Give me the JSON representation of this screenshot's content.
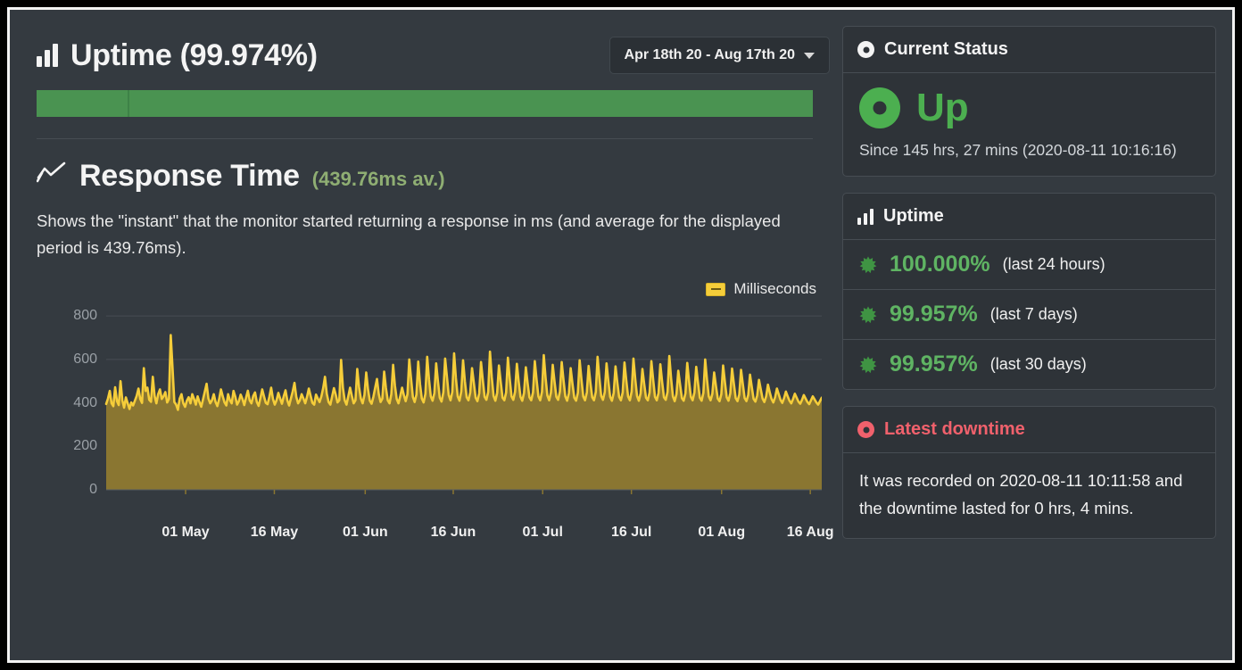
{
  "uptime_section": {
    "icon": "bar-chart-icon",
    "title": "Uptime (99.974%)",
    "date_range": "Apr 18th 20 - Aug 17th 20",
    "caret_icon": "chevron-down-icon",
    "bar_color": "#4a9351",
    "bar_segments": [
      {
        "label": "segment-1",
        "percent": 11.8
      },
      {
        "label": "segment-2",
        "percent": 88.2
      }
    ]
  },
  "response_section": {
    "icon": "line-chart-icon",
    "title": "Response Time",
    "average_label": "(439.76ms av.)",
    "average_color": "#8fae73",
    "description": "Shows the \"instant\" that the monitor started returning a response in ms (and average for the displayed period is 439.76ms)."
  },
  "chart_data": {
    "type": "area",
    "title": "Response Time",
    "xlabel": "",
    "ylabel": "Milliseconds",
    "ylim": [
      0,
      850
    ],
    "yticks": [
      0,
      200,
      400,
      600,
      800
    ],
    "grid": true,
    "legend": {
      "position": "top-right",
      "entries": [
        {
          "name": "Milliseconds",
          "color": "#f5cd3a"
        }
      ]
    },
    "line_color": "#f5cd3a",
    "fill_color": "#8a7631",
    "xtick_labels": [
      "01 May",
      "16 May",
      "01 Jun",
      "16 Jun",
      "01 Jul",
      "16 Jul",
      "01 Aug",
      "16 Aug"
    ],
    "xtick_positions": [
      11.1,
      23.5,
      36.2,
      48.5,
      61.0,
      73.4,
      86.0,
      98.4
    ],
    "x_start_label": "Apr 18",
    "x_end_label": "Aug 17",
    "values": [
      395,
      420,
      455,
      398,
      385,
      472,
      408,
      390,
      500,
      412,
      378,
      425,
      398,
      372,
      402,
      388,
      410,
      432,
      466,
      418,
      400,
      560,
      455,
      470,
      414,
      405,
      520,
      432,
      398,
      440,
      462,
      418,
      430,
      450,
      402,
      418,
      712,
      560,
      404,
      392,
      368,
      420,
      440,
      398,
      382,
      410,
      426,
      398,
      440,
      418,
      392,
      430,
      404,
      382,
      416,
      452,
      488,
      420,
      398,
      412,
      440,
      404,
      385,
      418,
      462,
      430,
      402,
      388,
      440,
      412,
      398,
      455,
      428,
      392,
      408,
      438,
      418,
      390,
      424,
      456,
      412,
      398,
      432,
      448,
      404,
      386,
      422,
      462,
      430,
      400,
      394,
      428,
      470,
      418,
      392,
      412,
      446,
      420,
      396,
      430,
      458,
      412,
      388,
      420,
      452,
      492,
      428,
      398,
      412,
      440,
      420,
      398,
      428,
      466,
      432,
      400,
      392,
      438,
      420,
      404,
      430,
      468,
      520,
      442,
      404,
      392,
      430,
      468,
      438,
      402,
      412,
      598,
      470,
      412,
      392,
      430,
      470,
      432,
      398,
      412,
      556,
      472,
      420,
      398,
      436,
      540,
      462,
      410,
      396,
      428,
      470,
      510,
      440,
      404,
      420,
      544,
      468,
      412,
      398,
      440,
      575,
      480,
      418,
      398,
      432,
      470,
      436,
      408,
      440,
      600,
      512,
      428,
      404,
      438,
      590,
      486,
      420,
      402,
      442,
      612,
      508,
      430,
      410,
      445,
      582,
      498,
      424,
      406,
      448,
      604,
      520,
      436,
      412,
      450,
      628,
      514,
      430,
      410,
      452,
      596,
      500,
      426,
      412,
      448,
      560,
      492,
      424,
      408,
      444,
      588,
      505,
      428,
      414,
      450,
      636,
      518,
      432,
      410,
      446,
      572,
      496,
      424,
      412,
      448,
      608,
      512,
      430,
      414,
      452,
      580,
      498,
      428,
      410,
      446,
      564,
      490,
      426,
      412,
      448,
      592,
      506,
      430,
      412,
      450,
      620,
      516,
      434,
      412,
      448,
      575,
      498,
      428,
      414,
      452,
      588,
      505,
      430,
      410,
      444,
      560,
      488,
      424,
      410,
      446,
      596,
      508,
      430,
      412,
      448,
      570,
      492,
      426,
      412,
      450,
      612,
      516,
      432,
      414,
      450,
      582,
      500,
      428,
      410,
      446,
      568,
      494,
      428,
      412,
      448,
      586,
      504,
      430,
      412,
      452,
      604,
      510,
      432,
      410,
      444,
      556,
      486,
      424,
      412,
      448,
      592,
      506,
      428,
      412,
      446,
      578,
      496,
      426,
      414,
      450,
      616,
      512,
      430,
      408,
      440,
      548,
      484,
      422,
      410,
      444,
      584,
      500,
      428,
      412,
      448,
      566,
      492,
      424,
      410,
      446,
      600,
      508,
      430,
      412,
      442,
      540,
      478,
      420,
      408,
      440,
      572,
      496,
      426,
      410,
      444,
      558,
      488,
      422,
      408,
      438,
      552,
      486,
      422,
      408,
      436,
      530,
      472,
      418,
      406,
      434,
      506,
      462,
      420,
      404,
      430,
      484,
      448,
      418,
      402,
      426,
      466,
      440,
      414,
      400,
      422,
      452,
      430,
      410,
      398,
      418,
      442,
      424,
      406,
      396,
      414,
      436,
      420,
      404,
      394,
      412,
      430,
      416,
      402,
      392,
      408,
      424
    ]
  },
  "sidebar": {
    "current_status": {
      "header_icon": "status-ring-icon",
      "header": "Current Status",
      "state_icon": "status-ring-large-icon",
      "state": "Up",
      "state_color": "#4caf50",
      "since": "Since 145 hrs, 27 mins (2020-08-11 10:16:16)"
    },
    "uptime": {
      "header_icon": "bar-chart-icon",
      "header": "Uptime",
      "rows": [
        {
          "badge_icon": "starburst-icon",
          "percent": "100.000%",
          "period": "(last 24 hours)"
        },
        {
          "badge_icon": "starburst-icon",
          "percent": "99.957%",
          "period": "(last 7 days)"
        },
        {
          "badge_icon": "starburst-icon",
          "percent": "99.957%",
          "period": "(last 30 days)"
        }
      ]
    },
    "latest_downtime": {
      "header_icon": "alert-ring-icon",
      "header": "Latest downtime",
      "header_color": "#f0616c",
      "text": "It was recorded on 2020-08-11 10:11:58 and the downtime lasted for 0 hrs, 4 mins."
    }
  }
}
